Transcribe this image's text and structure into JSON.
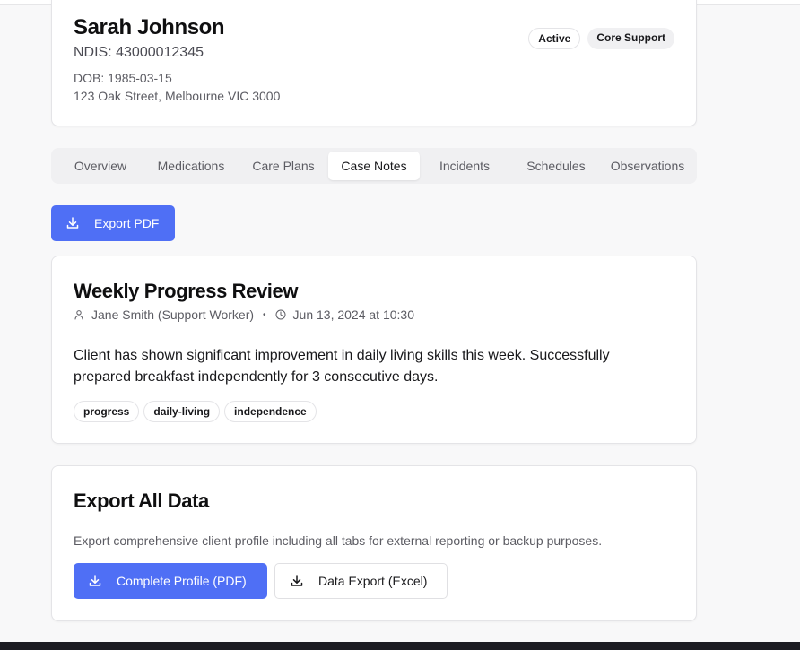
{
  "client": {
    "name": "Sarah Johnson",
    "ndis": "NDIS: 43000012345",
    "dob": "DOB: 1985-03-15",
    "address": "123 Oak Street, Melbourne VIC 3000",
    "badges": [
      "Active",
      "Core Support"
    ]
  },
  "tabs": [
    {
      "label": "Overview"
    },
    {
      "label": "Medications"
    },
    {
      "label": "Care Plans"
    },
    {
      "label": "Case Notes",
      "active": true
    },
    {
      "label": "Incidents"
    },
    {
      "label": "Schedules"
    },
    {
      "label": "Observations"
    }
  ],
  "toolbar": {
    "export_pdf_label": "Export PDF",
    "export_icon": "download-icon"
  },
  "note": {
    "title": "Weekly Progress Review",
    "author": "Jane Smith (Support Worker)",
    "separator": "•",
    "datetime": "Jun 13, 2024 at 10:30",
    "body": "Client has shown significant improvement in daily living skills this week. Successfully prepared breakfast independently for 3 consecutive days.",
    "tags": [
      "progress",
      "daily-living",
      "independence"
    ],
    "author_icon": "user-icon",
    "time_icon": "clock-icon"
  },
  "export_all": {
    "title": "Export All Data",
    "description": "Export comprehensive client profile including all tabs for external reporting or backup purposes.",
    "complete_profile_label": "Complete Profile (PDF)",
    "data_export_label": "Data Export (Excel)"
  },
  "colors": {
    "primary": "#4f6ff5",
    "background": "#f8f8f9",
    "card": "#ffffff",
    "muted_text": "#5c5c63",
    "footer": "#1c1c22"
  }
}
